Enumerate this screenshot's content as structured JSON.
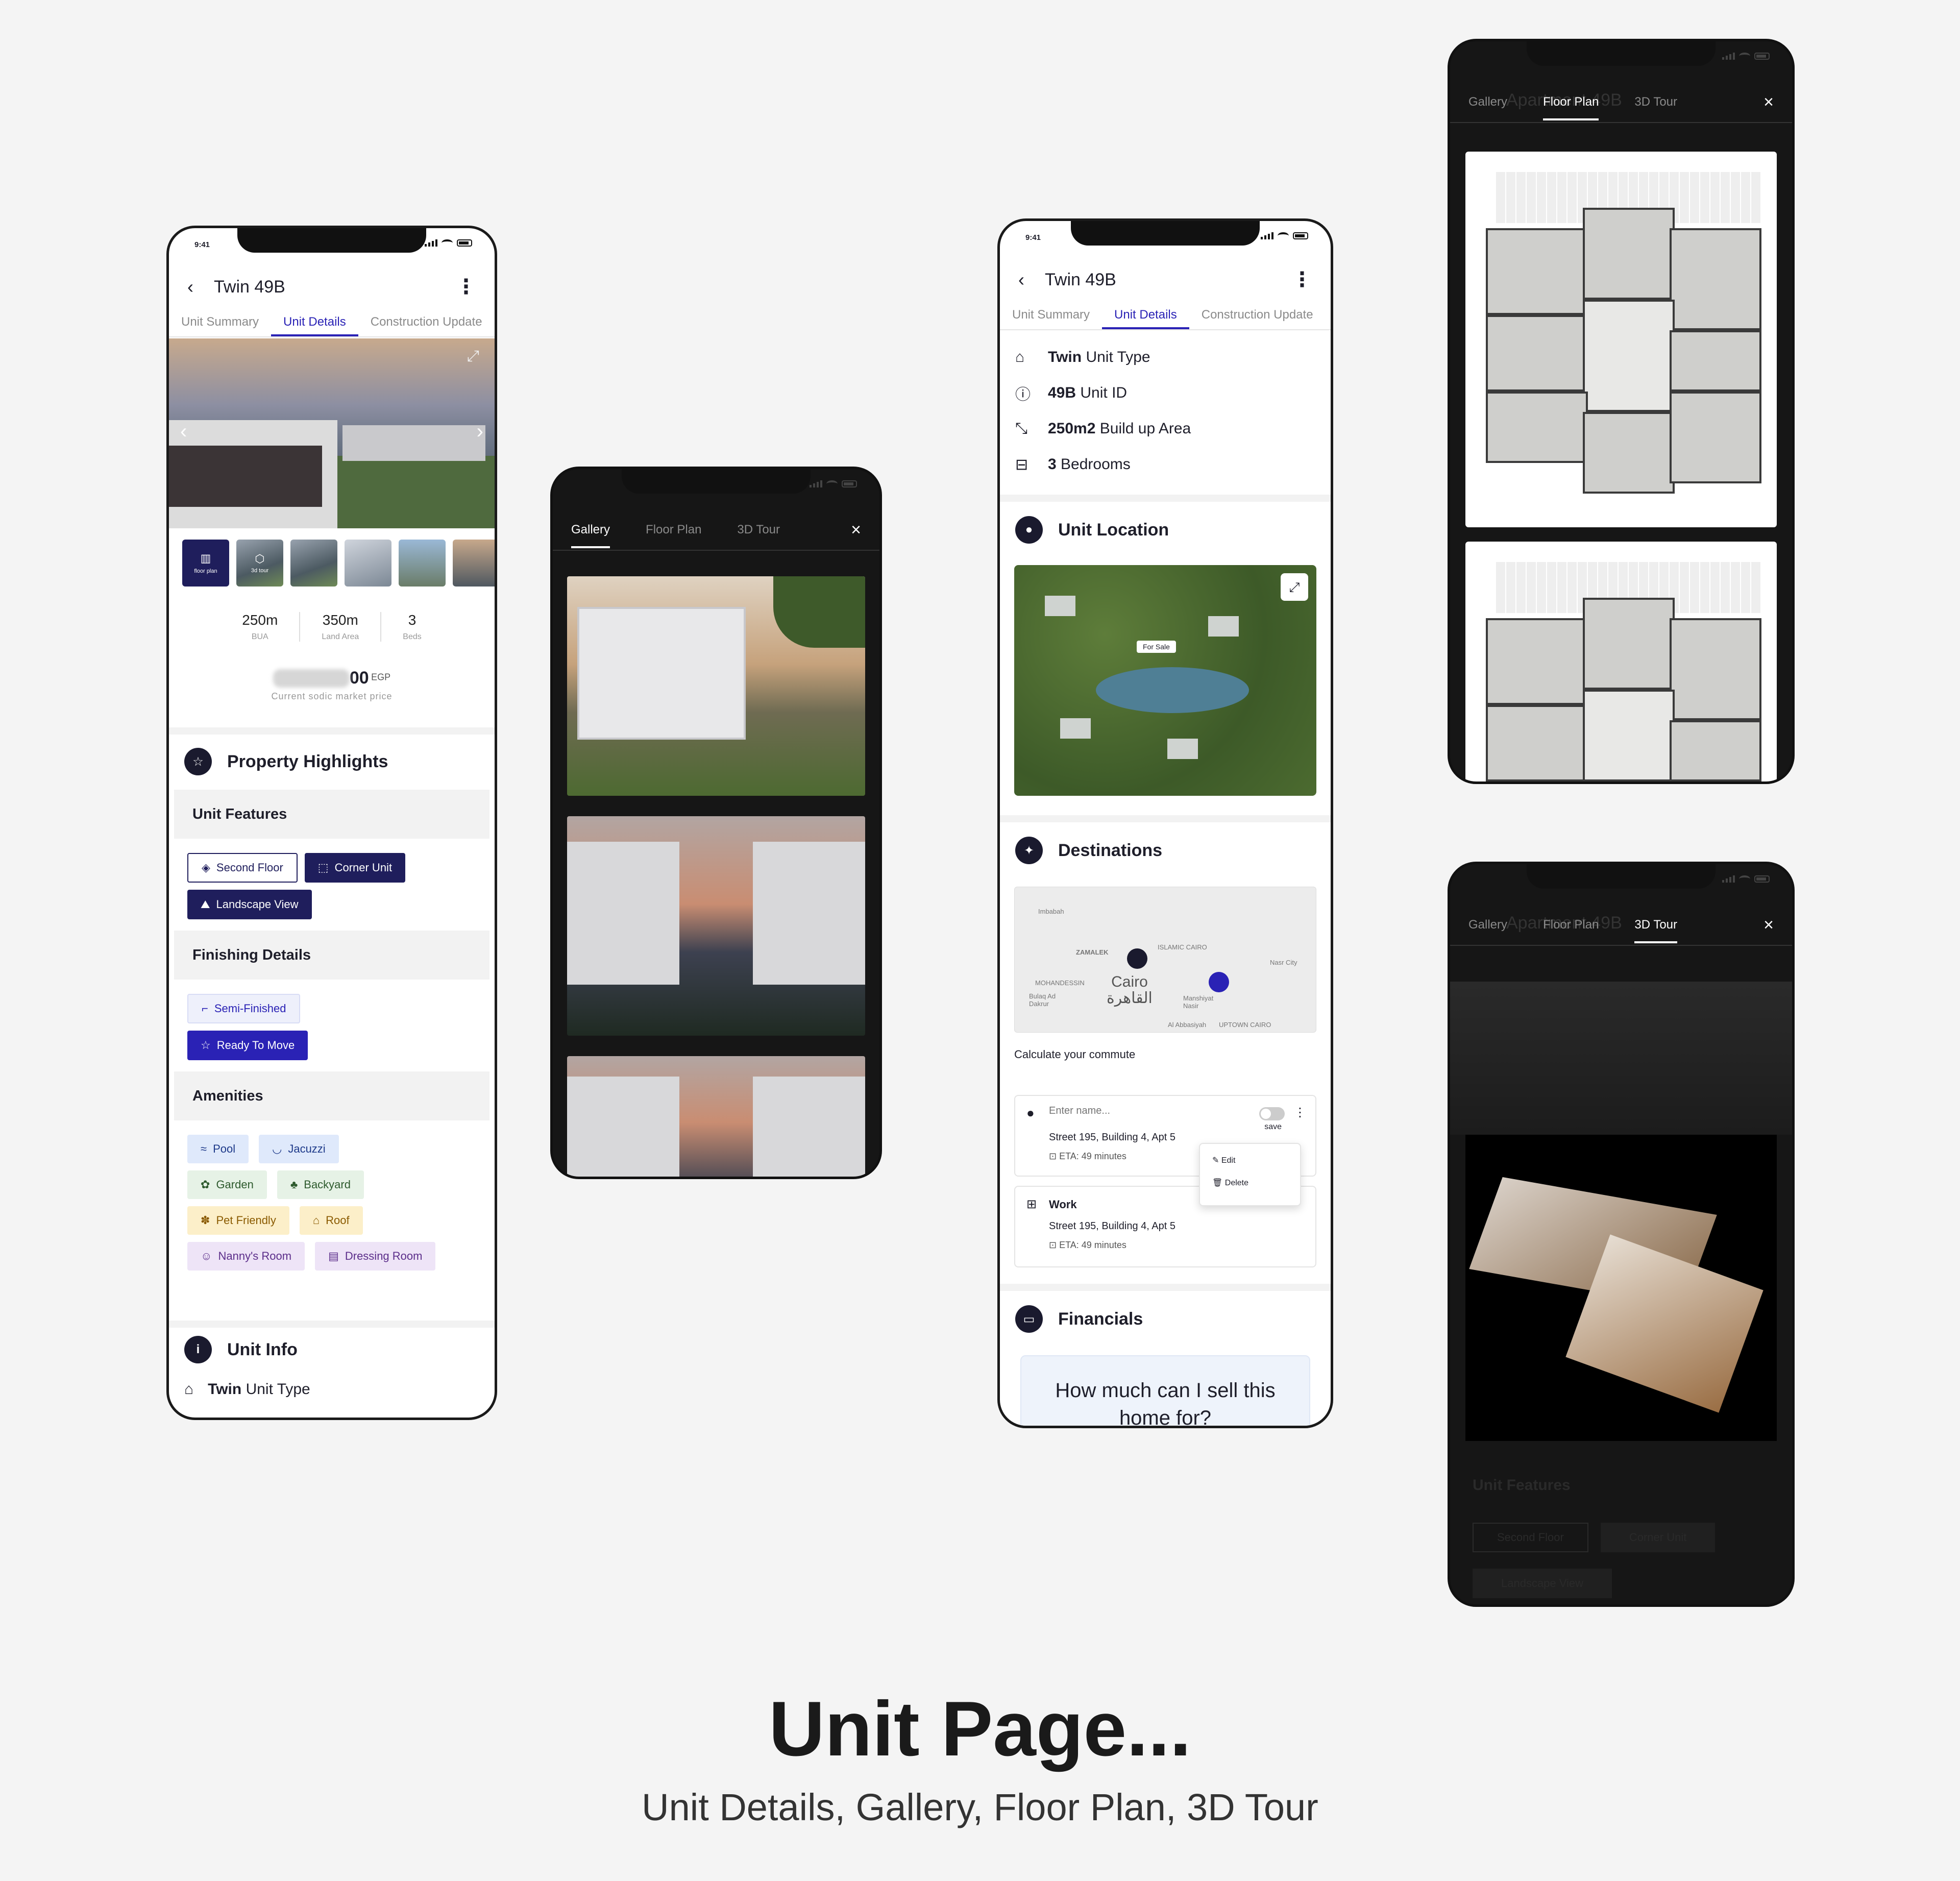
{
  "caption": {
    "title": "Unit Page...",
    "subtitle": "Unit Details, Gallery, Floor Plan, 3D Tour"
  },
  "status": {
    "time": "9:41"
  },
  "colors": {
    "accent": "#2a22b5",
    "navy": "#1f1e5c",
    "page_bg": "#f4f4f4"
  },
  "phone1": {
    "title": "Twin 49B",
    "tabs": [
      "Unit Summary",
      "Unit Details",
      "Construction Update"
    ],
    "active_tab": 1,
    "thumbs": {
      "floor_plan": "floor plan",
      "tour": "3d tour"
    },
    "stats": [
      {
        "value": "250m",
        "label": "BUA"
      },
      {
        "value": "350m",
        "label": "Land Area"
      },
      {
        "value": "3",
        "label": "Beds"
      }
    ],
    "price": {
      "value": "00",
      "currency": "EGP",
      "note": "Current sodic market price"
    },
    "highlights": {
      "title": "Property Highlights",
      "unit_features": {
        "title": "Unit Features",
        "items": [
          "Second Floor",
          "Corner Unit",
          "Landscape View"
        ]
      },
      "finishing": {
        "title": "Finishing Details",
        "items": [
          "Semi-Finished",
          "Ready To Move"
        ]
      },
      "amenities": {
        "title": "Amenities",
        "items": [
          "Pool",
          "Jacuzzi",
          "Garden",
          "Backyard",
          "Pet Friendly",
          "Roof",
          "Nanny's Room",
          "Dressing Room"
        ]
      }
    },
    "unit_info": {
      "title": "Unit Info",
      "type_bold": "Twin",
      "type_label": "Unit Type"
    }
  },
  "phone2": {
    "tabs": [
      "Gallery",
      "Floor Plan",
      "3D Tour"
    ],
    "active_tab": 0
  },
  "phone3": {
    "title": "Twin 49B",
    "tabs": [
      "Unit Summary",
      "Unit Details",
      "Construction Update"
    ],
    "details": [
      {
        "bold": "Twin",
        "label": "Unit Type",
        "icon": "home-icon"
      },
      {
        "bold": "49B",
        "label": "Unit ID",
        "icon": "info-icon"
      },
      {
        "bold": "250m2",
        "label": "Build up Area",
        "icon": "area-icon"
      },
      {
        "bold": "3",
        "label": "Bedrooms",
        "icon": "bed-icon"
      }
    ],
    "location": {
      "title": "Unit Location",
      "tag": "For Sale"
    },
    "destinations": {
      "title": "Destinations",
      "city": "Cairo",
      "city_ar": "القاهرة",
      "commute": "Calculate your commute",
      "map_labels": [
        "Imbabah",
        "ZAMALEK",
        "MOHANDESSIN",
        "Bulaq Ad Dakrur",
        "ISLAMIC CAIRO",
        "Nasr City",
        "Manshiyat Nasir",
        "Al Abbasiyah",
        "UPTOWN CAIRO"
      ]
    },
    "entry": {
      "placeholder": "Enter name...",
      "save": "save",
      "address": "Street 195, Building 4, Apt 5",
      "eta": "ETA: 49 minutes"
    },
    "menu": {
      "edit": "Edit",
      "delete": "Delete"
    },
    "work": {
      "name": "Work",
      "address": "Street 195, Building 4, Apt 5",
      "eta": "ETA: 49 minutes"
    },
    "financials": {
      "title": "Financials",
      "question": "How much can I sell this home for?"
    }
  },
  "phone4": {
    "tabs": [
      "Gallery",
      "Floor Plan",
      "3D Tour"
    ],
    "active_tab": 1,
    "ghost_title": "Apartment 49B"
  },
  "phone5": {
    "tabs": [
      "Gallery",
      "Floor Plan",
      "3D Tour"
    ],
    "active_tab": 2,
    "ghost_title": "Apartment 49B",
    "ghost": {
      "title": "Unit Features",
      "items": [
        "Second Floor",
        "Corner Unit",
        "Landscape View"
      ]
    }
  }
}
